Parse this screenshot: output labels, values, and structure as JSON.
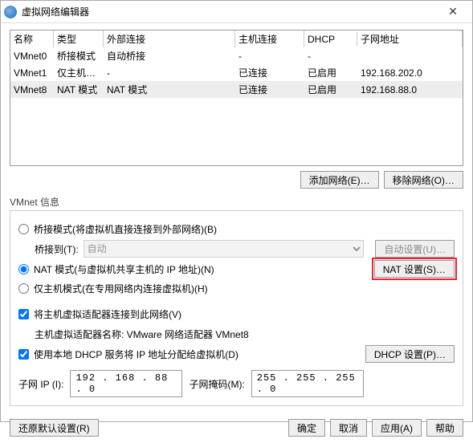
{
  "title": "虚拟网络编辑器",
  "table": {
    "headers": [
      "名称",
      "类型",
      "外部连接",
      "主机连接",
      "DHCP",
      "子网地址"
    ],
    "rows": [
      {
        "name": "VMnet0",
        "type": "桥接模式",
        "ext": "自动桥接",
        "host": "-",
        "dhcp": "-",
        "subnet": ""
      },
      {
        "name": "VMnet1",
        "type": "仅主机…",
        "ext": "-",
        "host": "已连接",
        "dhcp": "已启用",
        "subnet": "192.168.202.0"
      },
      {
        "name": "VMnet8",
        "type": "NAT 模式",
        "ext": "NAT 模式",
        "host": "已连接",
        "dhcp": "已启用",
        "subnet": "192.168.88.0"
      }
    ]
  },
  "buttons": {
    "addNet": "添加网络(E)…",
    "removeNet": "移除网络(O)…",
    "autoSetup": "自动设置(U)…",
    "natSetup": "NAT 设置(S)…",
    "dhcpSetup": "DHCP 设置(P)…",
    "restore": "还原默认设置(R)",
    "ok": "确定",
    "cancel": "取消",
    "apply": "应用(A)",
    "help": "帮助"
  },
  "group": {
    "label": "VMnet 信息",
    "bridge": "桥接模式(将虚拟机直接连接到外部网络)(B)",
    "bridgeToLabel": "桥接到(T):",
    "bridgeToValue": "自动",
    "nat": "NAT 模式(与虚拟机共享主机的 IP 地址)(N)",
    "hostonly": "仅主机模式(在专用网络内连接虚拟机)(H)",
    "connectHost": "将主机虚拟适配器连接到此网络(V)",
    "hostAdapter": "主机虚拟适配器名称: VMware 网络适配器 VMnet8",
    "useDHCP": "使用本地 DHCP 服务将 IP 地址分配给虚拟机(D)",
    "subnetIP": "子网 IP (I):",
    "subnetIPValue": "192 . 168 . 88 . 0",
    "subnetMask": "子网掩码(M):",
    "subnetMaskValue": "255 . 255 . 255 . 0"
  }
}
